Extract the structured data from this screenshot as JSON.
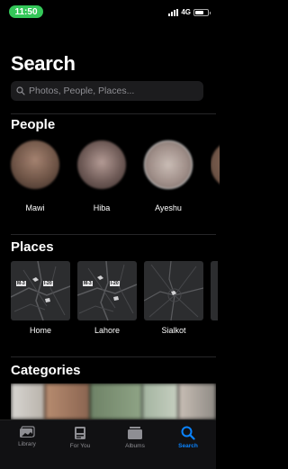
{
  "status": {
    "time": "11:50",
    "network": "4G",
    "battery_level": 0.7
  },
  "page": {
    "title": "Search"
  },
  "search": {
    "placeholder": "Photos, People, Places..."
  },
  "people": {
    "heading": "People",
    "items": [
      {
        "name": "Mawi",
        "color": "#8a6a58"
      },
      {
        "name": "Hiba",
        "color": "#7d6a66"
      },
      {
        "name": "Ayeshu",
        "color": "#9b8e8a"
      }
    ]
  },
  "places": {
    "heading": "Places",
    "items": [
      {
        "name": "Home",
        "road_labels": [
          "M-3",
          "I-20"
        ]
      },
      {
        "name": "Lahore",
        "road_labels": [
          "M-3",
          "I-20"
        ]
      },
      {
        "name": "Sialkot",
        "road_labels": []
      }
    ]
  },
  "categories": {
    "heading": "Categories"
  },
  "tabs": [
    {
      "label": "Library",
      "icon": "library-icon",
      "active": false
    },
    {
      "label": "For You",
      "icon": "for-you-icon",
      "active": false
    },
    {
      "label": "Albums",
      "icon": "albums-icon",
      "active": false
    },
    {
      "label": "Search",
      "icon": "search-icon",
      "active": true
    }
  ],
  "colors": {
    "accent": "#0a84ff",
    "status_pill": "#34c759"
  }
}
